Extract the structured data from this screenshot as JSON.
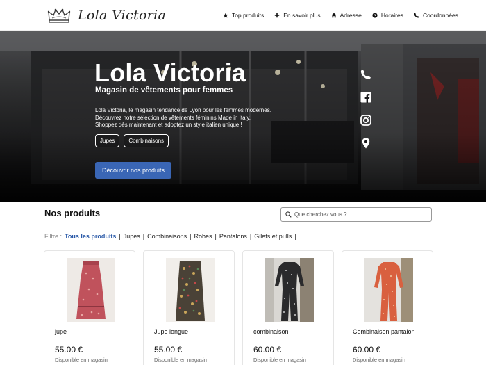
{
  "brand": {
    "name": "Lola Victoria",
    "logo_icon": "crown-icon"
  },
  "nav": [
    {
      "label": "Top produits",
      "icon": "star-icon"
    },
    {
      "label": "En savoir plus",
      "icon": "plus-icon"
    },
    {
      "label": "Adresse",
      "icon": "home-icon"
    },
    {
      "label": "Horaires",
      "icon": "clock-icon"
    },
    {
      "label": "Coordonnées",
      "icon": "phone-icon"
    }
  ],
  "hero": {
    "title": "Lola Victoria",
    "subtitle": "Magasin de vêtements pour femmes",
    "description": "Lola Victoria, le magasin tendance de Lyon pour les femmes modernes. Découvrez notre sélection de vêtements féminins Made in Italy. Shoppez dès maintenant et adoptez un style italien unique !",
    "tags": [
      "Jupes",
      "Combinaisons"
    ],
    "cta": "Découvrir nos produits",
    "social_icons": [
      "phone-icon",
      "facebook-icon",
      "instagram-icon",
      "map-pin-icon"
    ]
  },
  "products_section": {
    "title": "Nos produits",
    "search_placeholder": "Que cherchez vous ?",
    "filter_label": "Filtre :",
    "filters": [
      "Tous les produits",
      "Jupes",
      "Combinaisons",
      "Robes",
      "Pantalons",
      "Gilets et pulls"
    ],
    "active_filter": "Tous les produits"
  },
  "products": [
    {
      "name": "jupe",
      "price": "55.00 €",
      "status": "Disponible en magasin"
    },
    {
      "name": "Jupe longue",
      "price": "55.00 €",
      "status": "Disponible en magasin"
    },
    {
      "name": "combinaison",
      "price": "60.00 €",
      "status": "Disponible en magasin"
    },
    {
      "name": "Combinaison pantalon",
      "price": "60.00 €",
      "status": "Disponible en magasin"
    }
  ],
  "colors": {
    "accent": "#3a66b5",
    "active_filter": "#2b5aa8"
  }
}
